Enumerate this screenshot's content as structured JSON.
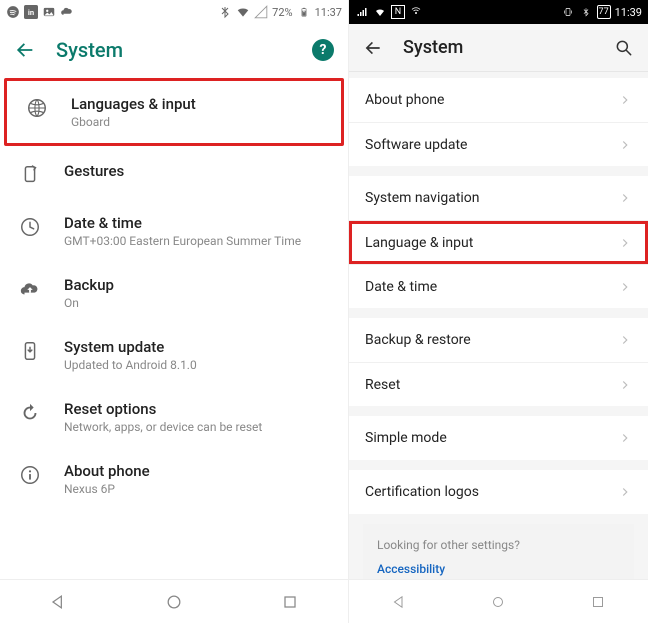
{
  "left": {
    "status": {
      "battery": "72%",
      "time": "11:37"
    },
    "header": {
      "title": "System",
      "help": "?"
    },
    "items": [
      {
        "title": "Languages & input",
        "sub": "Gboard"
      },
      {
        "title": "Gestures",
        "sub": ""
      },
      {
        "title": "Date & time",
        "sub": "GMT+03:00 Eastern European Summer Time"
      },
      {
        "title": "Backup",
        "sub": "On"
      },
      {
        "title": "System update",
        "sub": "Updated to Android 8.1.0"
      },
      {
        "title": "Reset options",
        "sub": "Network, apps, or device can be reset"
      },
      {
        "title": "About phone",
        "sub": "Nexus 6P"
      }
    ]
  },
  "right": {
    "status": {
      "battery": "77",
      "time": "11:39"
    },
    "header": {
      "title": "System"
    },
    "groups": [
      [
        {
          "title": "About phone"
        },
        {
          "title": "Software update"
        }
      ],
      [
        {
          "title": "System navigation"
        },
        {
          "title": "Language & input"
        },
        {
          "title": "Date & time"
        }
      ],
      [
        {
          "title": "Backup & restore"
        },
        {
          "title": "Reset"
        }
      ],
      [
        {
          "title": "Simple mode"
        }
      ],
      [
        {
          "title": "Certification logos"
        }
      ]
    ],
    "footer": {
      "q": "Looking for other settings?",
      "link": "Accessibility"
    }
  }
}
